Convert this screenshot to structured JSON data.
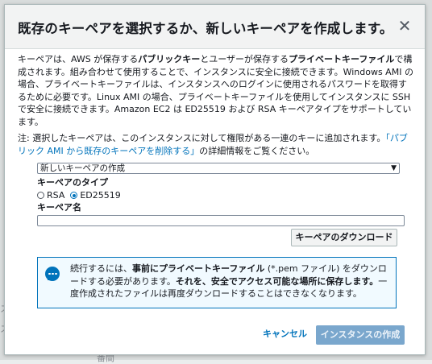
{
  "background": {
    "left_text_1": "ス",
    "left_text_2": "ス",
    "bottom_text": "番間"
  },
  "modal": {
    "title": "既存のキーペアを選択するか、新しいキーペアを作成します。",
    "close_icon": "close-icon",
    "description_parts": [
      {
        "text": "キーペアは、AWS が保存する",
        "bold": false
      },
      {
        "text": "パブリックキー",
        "bold": true
      },
      {
        "text": "とユーザーが保存する",
        "bold": false
      },
      {
        "text": "プライベートキーファイル",
        "bold": true
      },
      {
        "text": "で構成されます。組み合わせて使用することで、インスタンスに安全に接続できます。Windows AMI の場合、プライベートキーファイルは、インスタンスへのログインに使用されるパスワードを取得するために必要です。Linux AMI の場合、プライベートキーファイルを使用してインスタンスに SSH で安全に接続できます。Amazon EC2 は ED25519 および RSA キーペアタイプをサポートしています。",
        "bold": false
      }
    ],
    "note_prefix": "注: 選択したキーペアは、このインスタンスに対して権限がある一連のキーに追加されます。",
    "note_link": "「パブリック AMI から既存のキーペアを削除する」",
    "note_suffix": "の詳細情報をご覧ください。",
    "select_value": "新しいキーペアの作成",
    "key_type_label": "キーペアのタイプ",
    "radio_rsa": "RSA",
    "radio_ed": "ED25519",
    "selected_key_type": "ED25519",
    "key_name_label": "キーペア名",
    "key_name_value": "",
    "download_button": "キーペアのダウンロード",
    "info_parts": [
      {
        "text": "続行するには、",
        "bold": false
      },
      {
        "text": "事前にプライベートキーファイル",
        "bold": true
      },
      {
        "text": " (*.pem ファイル) をダウンロードする必要があります。",
        "bold": false
      },
      {
        "text": "それを、安全でアクセス可能な場所に保存します。",
        "bold": true
      },
      {
        "text": "一度作成されたファイルは再度ダウンロードすることはできなくなります。",
        "bold": false
      }
    ],
    "cancel_label": "キャンセル",
    "create_button": "インスタンスの作成"
  },
  "colors": {
    "accent": "#0073bb",
    "primary_disabled": "#7aa7cd",
    "info_bg": "#f1faff"
  }
}
